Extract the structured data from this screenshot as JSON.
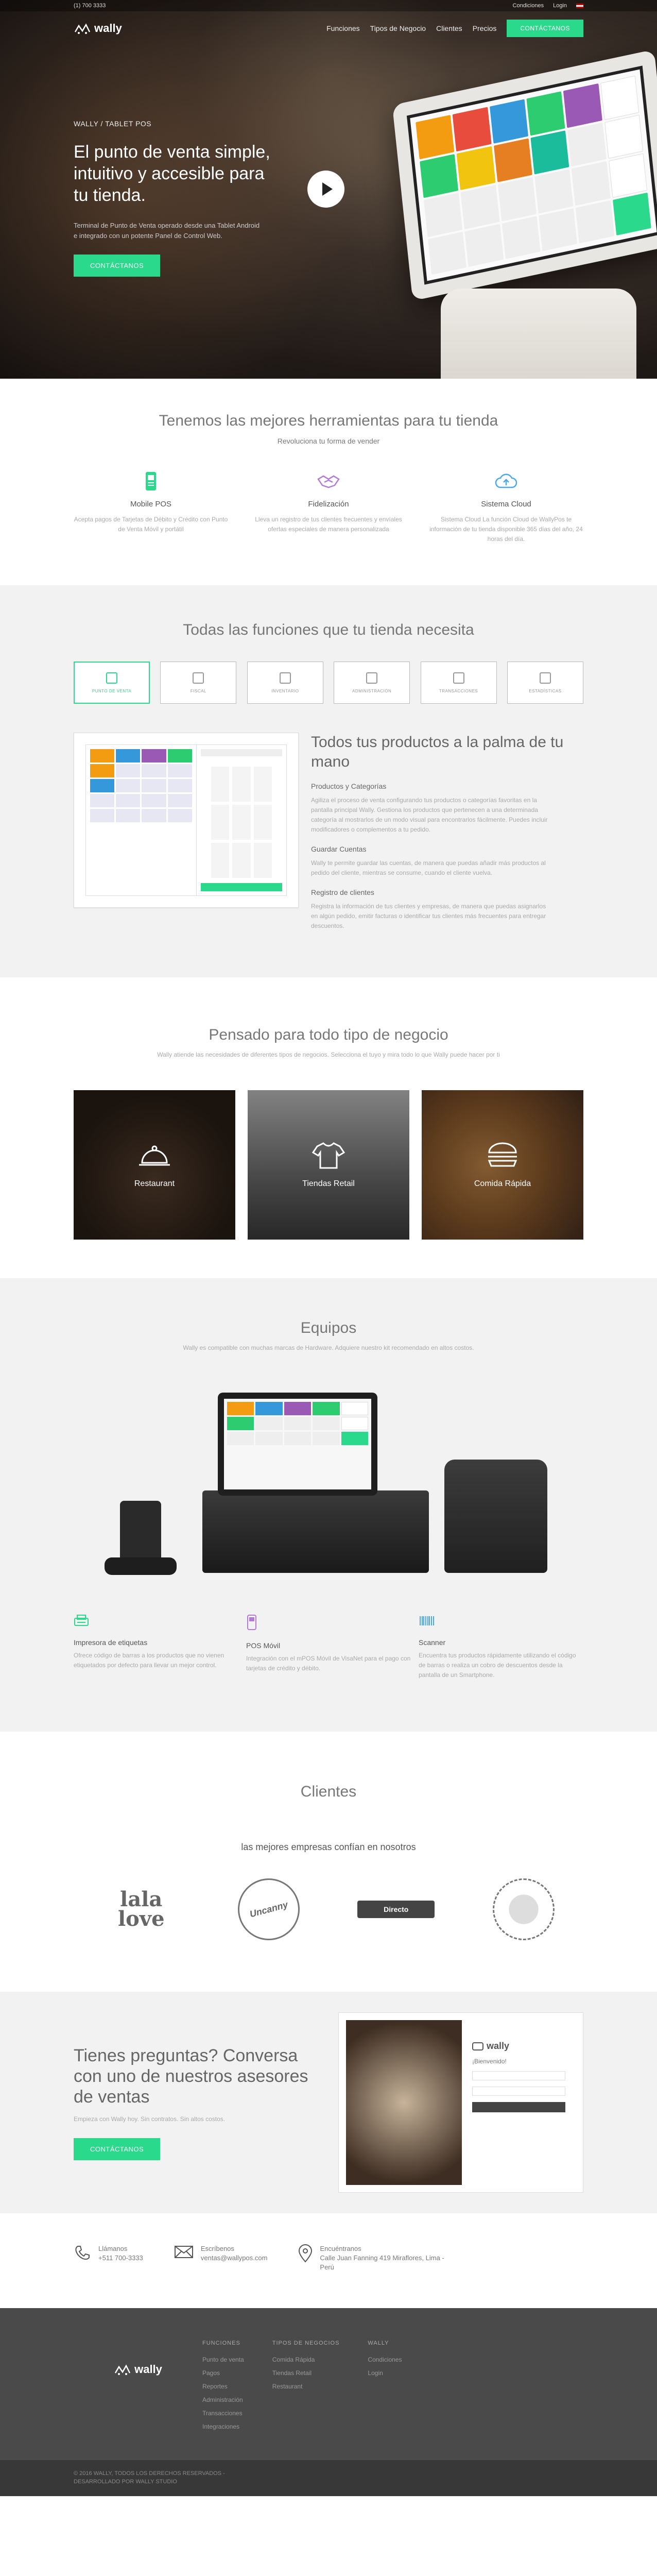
{
  "colors": {
    "accent": "#2bd98c",
    "dark": "#4a4a4a"
  },
  "topbar": {
    "phone": "(1) 700 3333",
    "lang1": "Condiciones",
    "login": "Login",
    "flag_icon": "peru-flag-icon"
  },
  "nav": {
    "brand": "wally",
    "items": [
      "Funciones",
      "Tipos de Negocio",
      "Clientes",
      "Precios"
    ],
    "cta": "CONTÁCTANOS"
  },
  "hero": {
    "sub": "WALLY / TABLET POS",
    "title": "El punto de venta simple, intuitivo y accesible para tu tienda.",
    "desc": "Terminal de Punto de Venta operado desde una Tablet Android e integrado con un potente Panel de Control Web.",
    "cta": "CONTÁCTANOS"
  },
  "tools": {
    "title": "Tenemos las mejores herramientas para tu tienda",
    "sub": "Revoluciona tu forma de vender",
    "items": [
      {
        "icon": "mobile-pos-icon",
        "title": "Mobile POS",
        "desc": "Acepta pagos de Tarjetas de Débito y Crédito con Punto de Venta Móvil y portátil"
      },
      {
        "icon": "handshake-icon",
        "title": "Fidelización",
        "desc": "Lleva un registro de tus clientes frecuentes y envíales ofertas especiales de manera personalizada"
      },
      {
        "icon": "cloud-icon",
        "title": "Sistema Cloud",
        "desc": "Sistema Cloud La función Cloud de WallyPos te información de tu tienda disponible 365 días del año, 24 horas del día."
      }
    ]
  },
  "features": {
    "title": "Todas las funciones que tu tienda necesita",
    "tabs": [
      "PUNTO DE VENTA",
      "FISCAL",
      "INVENTARIO",
      "ADMINISTRACIÓN",
      "TRANSACCIONES",
      "ESTADÍSTICAS"
    ],
    "heading": "Todos tus productos a la palma de tu mano",
    "blocks": [
      {
        "title": "Productos y Categorías",
        "text": "Agiliza el proceso de venta configurando tus productos o categorías favoritas en la pantalla principal Wally. Gestiona los productos que pertenecen a una determinada categoría al mostrarlos de un modo visual para encontrarlos fácilmente. Puedes incluir modificadores o complementos a tu pedido."
      },
      {
        "title": "Guardar Cuentas",
        "text": "Wally te permite guardar las cuentas, de manera que puedas añadir más productos al pedido del cliente, mientras se consume, cuando el cliente vuelva."
      },
      {
        "title": "Registro de clientes",
        "text": "Registra la información de tus clientes y empresas, de manera que puedas asignarlos en algún pedido, emitir facturas o identificar tus clientes más frecuentes para entregar descuentos."
      }
    ]
  },
  "business": {
    "title": "Pensado para todo tipo de negocio",
    "sub": "Wally atiende las necesidades de diferentes tipos de negocios. Selecciona el tuyo y mira todo lo que Wally puede hacer por ti",
    "items": [
      {
        "icon": "cloche-icon",
        "label": "Restaurant"
      },
      {
        "icon": "tshirt-icon",
        "label": "Tiendas Retail"
      },
      {
        "icon": "burger-icon",
        "label": "Comida Rápida"
      }
    ]
  },
  "equipos": {
    "title": "Equipos",
    "sub": "Wally es compatible con muchas marcas de Hardware. Adquiere nuestro kit recomendado en altos costos.",
    "items": [
      {
        "icon": "label-printer-icon",
        "title": "Impresora de etiquetas",
        "desc": "Ofrece código de barras a los productos que no vienen etiquetados por defecto para llevar un mejor control."
      },
      {
        "icon": "pos-movil-icon",
        "title": "POS Móvil",
        "desc": "Integración con el mPOS Móvil de VisaNet para el pago con tarjetas de crédito y débito."
      },
      {
        "icon": "scanner-icon",
        "title": "Scanner",
        "desc": "Encuentra tus productos rápidamente utilizando el código de barras o realiza un cobro de descuentos desde la pantalla de un Smartphone."
      }
    ]
  },
  "clientes": {
    "title": "Clientes",
    "sub": "las mejores empresas confían en nosotros",
    "logos": [
      {
        "name": "lala-love-logo",
        "text": "lala love"
      },
      {
        "name": "uncanny-logo",
        "text": "Uncanny"
      },
      {
        "name": "toast-directo-logo",
        "text": "Directo"
      },
      {
        "name": "pizza-seal-logo",
        "text": ""
      }
    ]
  },
  "contact": {
    "title": "Tienes preguntas? Conversa con uno de nuestros asesores de ventas",
    "sub": "Empieza con Wally hoy. Sin contratos. Sin altos costos.",
    "cta": "CONTÁCTANOS",
    "card_brand": "wally",
    "card_welcome": "¡Bienvenido!"
  },
  "info": [
    {
      "icon": "phone-icon",
      "line1": "Llámanos",
      "line2": "+511 700-3333"
    },
    {
      "icon": "mail-icon",
      "line1": "Escríbenos",
      "line2": "ventas@wallypos.com"
    },
    {
      "icon": "location-icon",
      "line1": "Encuéntranos",
      "line2": "Calle Juan Fanning 419 Miraflores, Lima - Perú"
    }
  ],
  "footer": {
    "brand": "wally",
    "cols": [
      {
        "title": "FUNCIONES",
        "items": [
          "Punto de venta",
          "Pagos",
          "Reportes",
          "Administración",
          "Transacciones",
          "Integraciones"
        ]
      },
      {
        "title": "TIPOS DE NEGOCIOS",
        "items": [
          "Comida Rápida",
          "Tiendas Retail",
          "Restaurant"
        ]
      },
      {
        "title": "WALLY",
        "items": [
          "Condiciones",
          "Login"
        ]
      }
    ],
    "copyright": "© 2016 WALLY, TODOS LOS DERECHOS RESERVADOS - DESARROLLADO POR WALLY STUDIO"
  }
}
